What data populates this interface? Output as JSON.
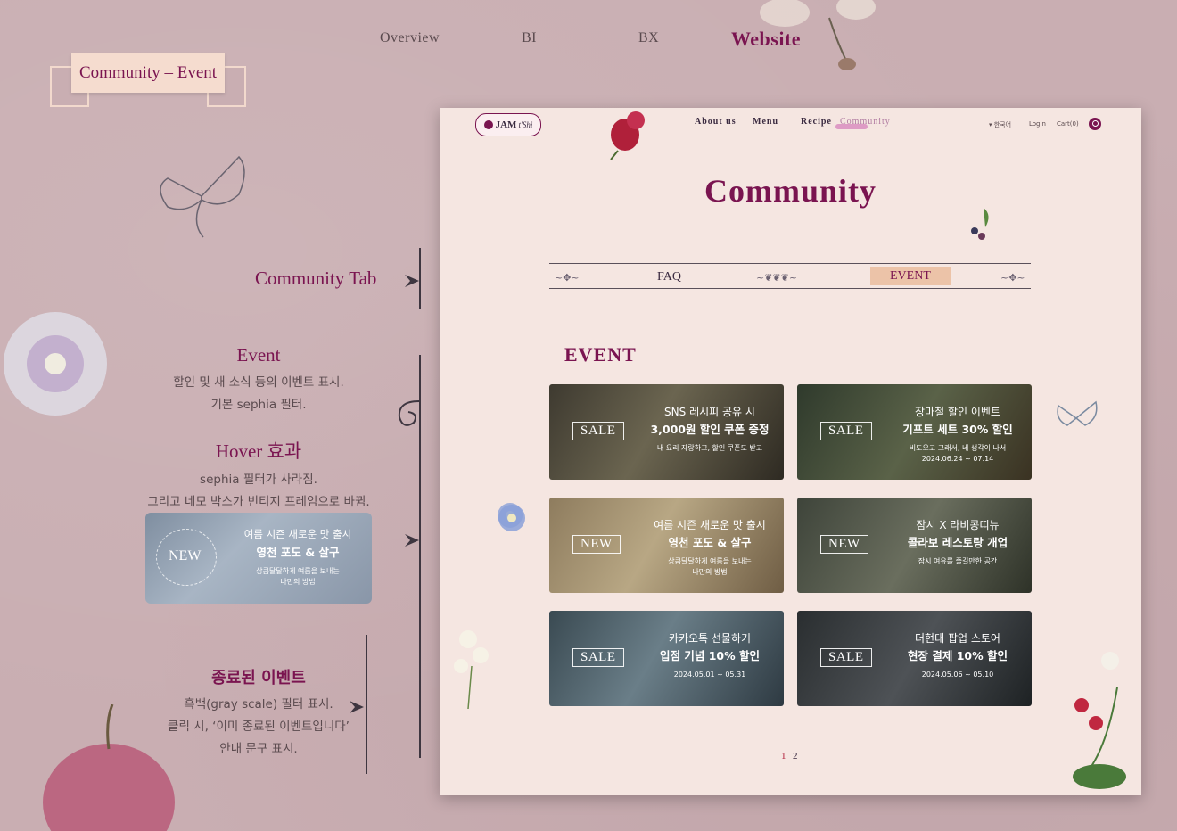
{
  "topnav": {
    "items": [
      "Overview",
      "BI",
      "BX",
      "Website"
    ],
    "active": "Website"
  },
  "ribbon": {
    "title": "Community – Event"
  },
  "annotations": {
    "tab_label": "Community Tab",
    "event": {
      "title": "Event",
      "line1": "할인 및 새 소식 등의 이벤트 표시.",
      "line2": "기본 sephia 필터."
    },
    "hover": {
      "title": "Hover 효과",
      "line1": "sephia 필터가 사라짐.",
      "line2": "그리고 네모 박스가 빈티지 프레임으로 바뀜."
    },
    "ended": {
      "title": "종료된 이벤트",
      "line1": "흑백(gray scale) 필터 표시.",
      "line2": "클릭 시, ‘이미 종료된 이벤트입니다’",
      "line3": "안내 문구 표시."
    },
    "hover_card": {
      "badge": "NEW",
      "l1": "여름 시즌 새로운 맛 출시",
      "l2": "영천 포도 & 살구",
      "l3a": "상큼달달하게 여름을 보내는",
      "l3b": "나만의 방법"
    }
  },
  "site": {
    "logo": "JAM",
    "logo_script": "t'Shi",
    "nav": [
      "About us",
      "Menu",
      "Recipe",
      "Community"
    ],
    "nav_active": "Community",
    "util": {
      "lang": "▾ 한국어",
      "login": "Login",
      "cart": "Cart(0)"
    },
    "title": "Community",
    "tabs": {
      "faq": "FAQ",
      "event": "EVENT",
      "active": "EVENT"
    },
    "section_title": "EVENT",
    "cards": [
      {
        "badge": "SALE",
        "l1": "SNS 레시피 공유 시",
        "l2": "3,000원 할인 쿠폰 증정",
        "l3": "내 요리 자랑하고, 할인 쿠폰도 받고",
        "l4": ""
      },
      {
        "badge": "SALE",
        "l1": "장마철 할인 이벤트",
        "l2": "기프트 세트 30% 할인",
        "l3": "비도오고 그래서, 네 생각이 나서",
        "l4": "2024.06.24 ~ 07.14"
      },
      {
        "badge": "NEW",
        "l1": "여름 시즌 새로운 맛 출시",
        "l2": "영천 포도 & 살구",
        "l3": "상큼달달하게 여름을 보내는",
        "l4": "나만의 방법"
      },
      {
        "badge": "NEW",
        "l1": "잠시 X 라비콩띠뉴",
        "l2": "콜라보 레스토랑 개업",
        "l3": "잠시 여유를 즐길만한 공간",
        "l4": ""
      },
      {
        "badge": "SALE",
        "l1": "카카오톡 선물하기",
        "l2": "입점 기념 10% 할인",
        "l3": "2024.05.01 ~ 05.31",
        "l4": ""
      },
      {
        "badge": "SALE",
        "l1": "더현대 팝업 스토어",
        "l2": "현장 결제 10% 할인",
        "l3": "2024.05.06 ~ 05.10",
        "l4": ""
      }
    ],
    "pagination": [
      "1",
      "2"
    ],
    "current_page": "1"
  },
  "colors": {
    "accent": "#7a1450",
    "background": "#c9aeb2",
    "panel": "#f5e6e1",
    "tab_highlight": "#ecc3a8"
  }
}
